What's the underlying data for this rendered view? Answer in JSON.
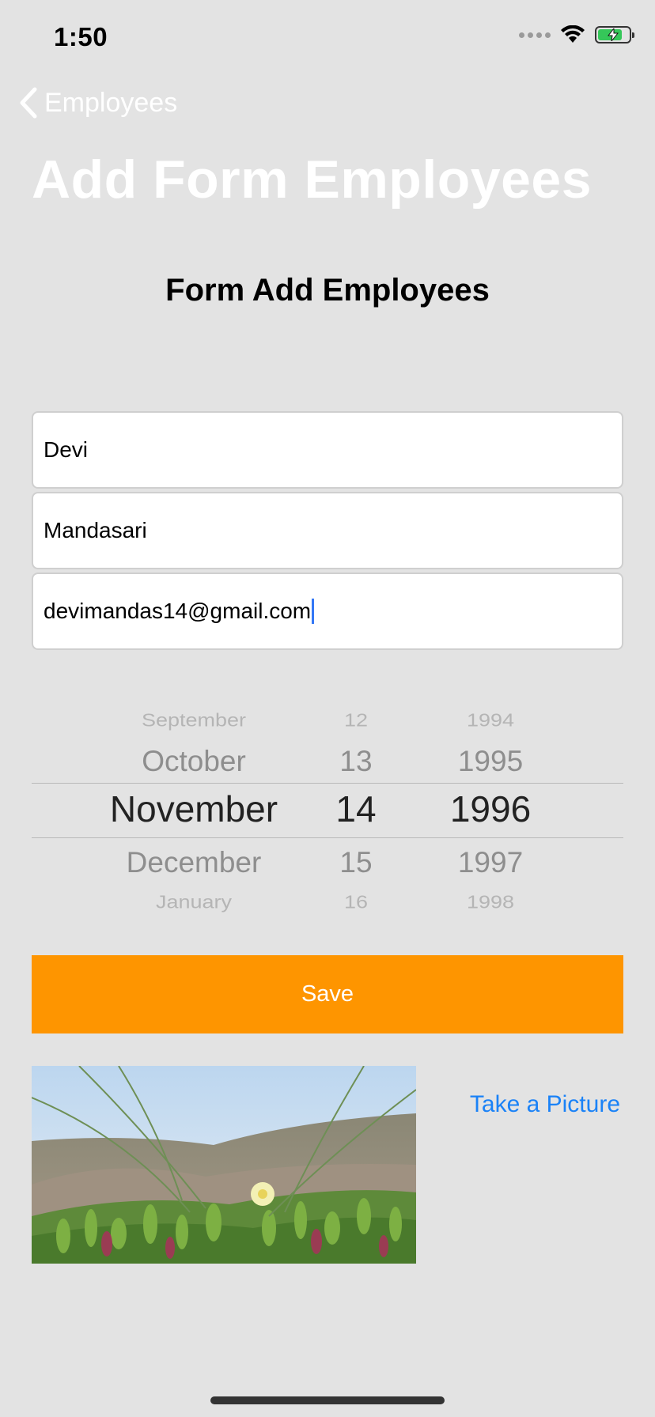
{
  "status_bar": {
    "time": "1:50"
  },
  "nav": {
    "back_label": "Employees",
    "large_title": "Add Form Employees"
  },
  "form": {
    "heading": "Form Add Employees",
    "first_name": "Devi",
    "last_name": "Mandasari",
    "email": "devimandas14@gmail.com"
  },
  "date_picker": {
    "months": [
      "September",
      "October",
      "November",
      "December",
      "January"
    ],
    "days": [
      "12",
      "13",
      "14",
      "15",
      "16"
    ],
    "years": [
      "1994",
      "1995",
      "1996",
      "1997",
      "1998"
    ],
    "selected": {
      "month": "November",
      "day": "14",
      "year": "1996"
    }
  },
  "save_label": "Save",
  "take_picture_label": "Take a Picture",
  "colors": {
    "background": "#e3e3e3",
    "accent_orange": "#fe9500",
    "link_blue": "#1a82f7",
    "battery_green": "#35c759"
  },
  "battery_level": 0.8
}
